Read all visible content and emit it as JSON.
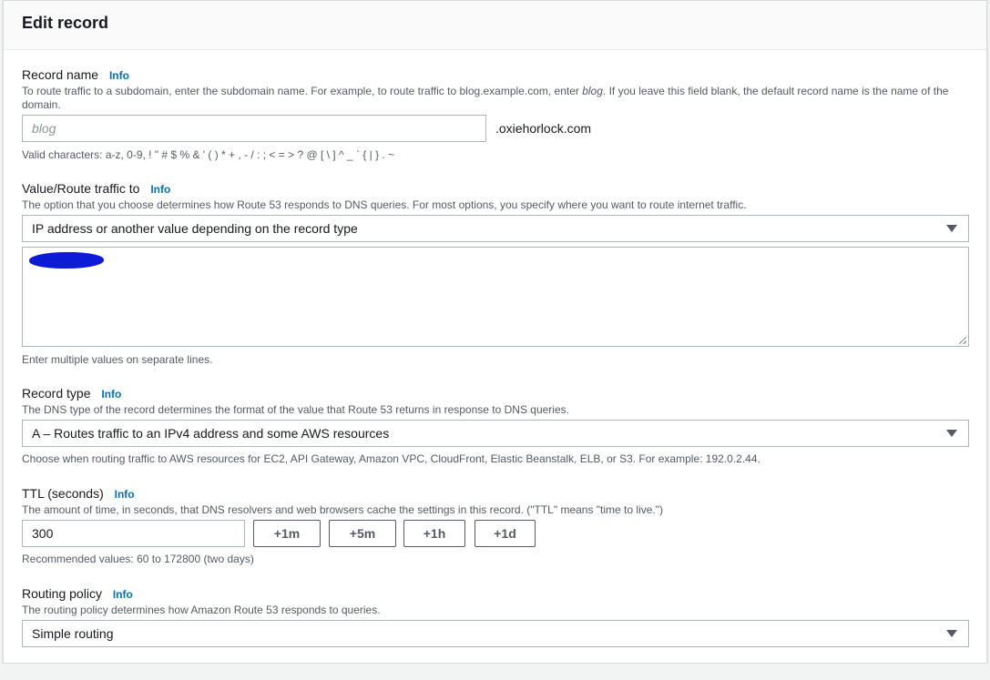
{
  "panel": {
    "title": "Edit record"
  },
  "info_label": "Info",
  "record_name": {
    "label": "Record name",
    "desc_before": "To route traffic to a subdomain, enter the subdomain name. For example, to route traffic to blog.example.com, enter ",
    "desc_em": "blog",
    "desc_after": ". If you leave this field blank, the default record name is the name of the domain.",
    "placeholder": "blog",
    "value": "",
    "suffix": ".oxiehorlock.com",
    "hint": "Valid characters: a-z, 0-9, ! \" # $ % & ' ( ) * + , - / : ; < = > ? @ [ \\ ] ^ _ ` { | } . ~"
  },
  "value_route": {
    "label": "Value/Route traffic to",
    "desc": "The option that you choose determines how Route 53 responds to DNS queries. For most options, you specify where you want to route internet traffic.",
    "selected": "IP address or another value depending on the record type",
    "hint": "Enter multiple values on separate lines."
  },
  "record_type": {
    "label": "Record type",
    "desc": "The DNS type of the record determines the format of the value that Route 53 returns in response to DNS queries.",
    "selected": "A – Routes traffic to an IPv4 address and some AWS resources",
    "hint": "Choose when routing traffic to AWS resources for EC2, API Gateway, Amazon VPC, CloudFront, Elastic Beanstalk, ELB, or S3. For example: 192.0.2.44."
  },
  "ttl": {
    "label": "TTL (seconds)",
    "desc": "The amount of time, in seconds, that DNS resolvers and web browsers cache the settings in this record. (\"TTL\" means \"time to live.\")",
    "value": "300",
    "buttons": [
      "+1m",
      "+5m",
      "+1h",
      "+1d"
    ],
    "hint": "Recommended values: 60 to 172800 (two days)"
  },
  "routing_policy": {
    "label": "Routing policy",
    "desc": "The routing policy determines how Amazon Route 53 responds to queries.",
    "selected": "Simple routing"
  },
  "colors": {
    "info_link": "#0073bb",
    "redaction": "#0b1bd6",
    "border": "#aab7b8"
  }
}
